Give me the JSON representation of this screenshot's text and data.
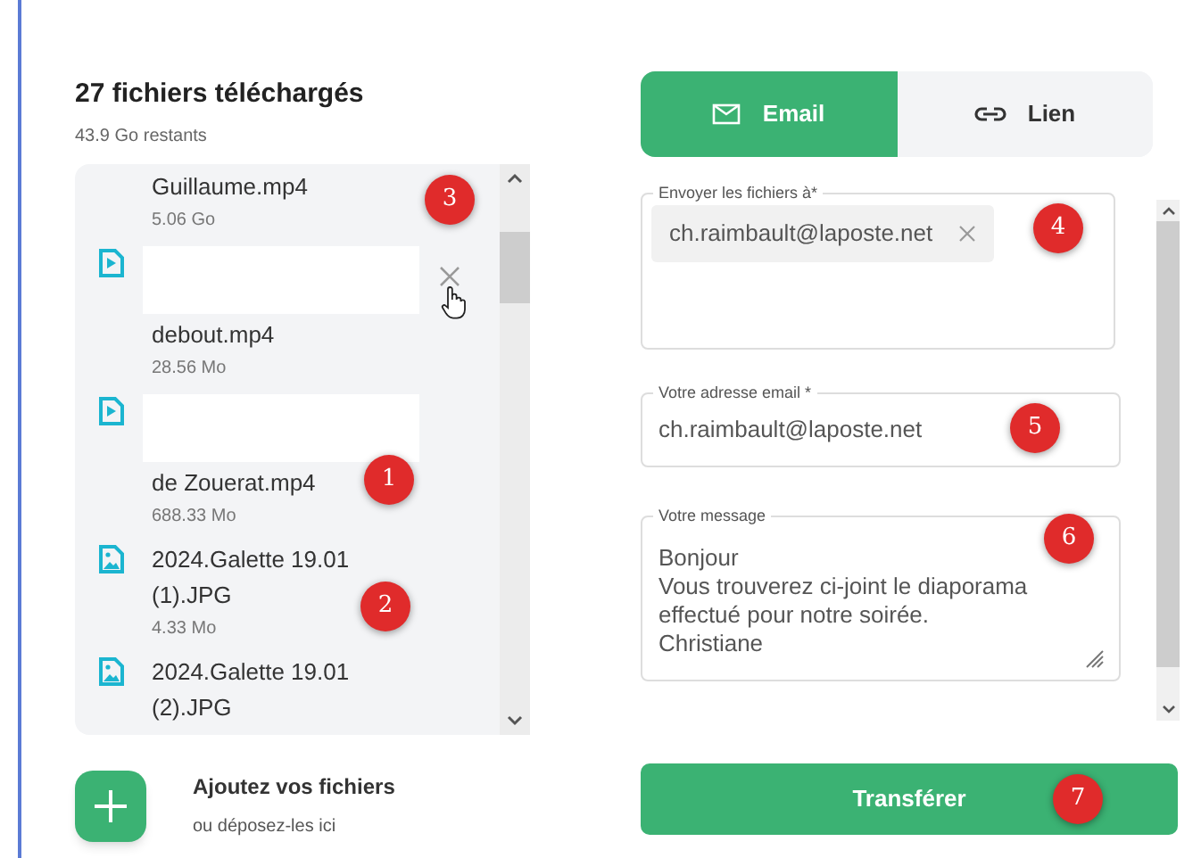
{
  "upload": {
    "title": "27 fichiers téléchargés",
    "remaining": "43.9 Go restants",
    "files": [
      {
        "kind": "video",
        "redacted": false,
        "name": "Guillaume.mp4",
        "size": "5.06 Go",
        "remove_button": false
      },
      {
        "kind": "video",
        "redacted": true,
        "name": "debout.mp4",
        "size": "28.56 Mo",
        "remove_button": true
      },
      {
        "kind": "video",
        "redacted": true,
        "name": "de Zouerat.mp4",
        "size": "688.33 Mo",
        "remove_button": false
      },
      {
        "kind": "image",
        "redacted": false,
        "name": "2024.Galette 19.01 (1).JPG",
        "size": "4.33 Mo",
        "remove_button": false
      },
      {
        "kind": "image",
        "redacted": false,
        "name": "2024.Galette 19.01 (2).JPG",
        "remove_button": false
      }
    ],
    "add": {
      "label": "Ajoutez vos fichiers",
      "hint": "ou déposez-les ici"
    }
  },
  "send": {
    "tabs": [
      {
        "kind": "email",
        "label": "Email",
        "selected": true
      },
      {
        "kind": "link",
        "label": "Lien",
        "selected": false
      }
    ],
    "recipients": {
      "label": "Envoyer les fichiers à*",
      "chips": [
        "ch.raimbault@laposte.net"
      ]
    },
    "sender": {
      "label": "Votre adresse email *",
      "value": "ch.raimbault@laposte.net"
    },
    "message": {
      "label": "Votre message",
      "value": "Bonjour\nVous trouverez ci-joint le diaporama\neffectué pour notre soirée.\nChristiane"
    },
    "submit": "Transférer"
  },
  "annotations": [
    "3",
    "1",
    "2",
    "4",
    "5",
    "6",
    "7"
  ]
}
